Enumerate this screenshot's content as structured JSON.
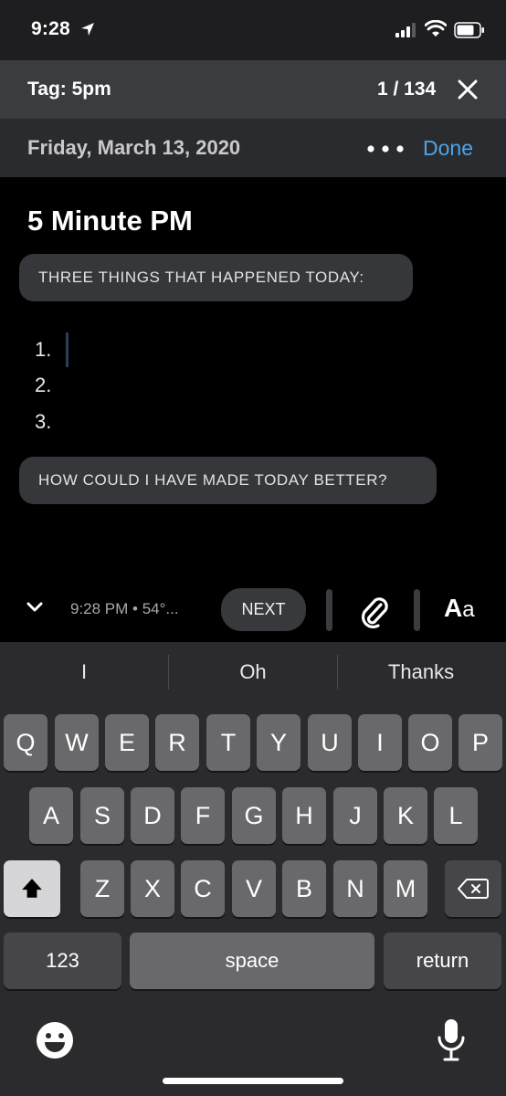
{
  "status_bar": {
    "time": "9:28"
  },
  "tag_bar": {
    "label": "Tag: 5pm",
    "count": "1 / 134"
  },
  "date_bar": {
    "date": "Friday, March 13, 2020",
    "done_label": "Done"
  },
  "entry": {
    "title": "5 Minute PM",
    "prompt_1": "THREE THINGS THAT HAPPENED TODAY:",
    "list": [
      "1.",
      "2.",
      "3."
    ],
    "prompt_2": "HOW COULD I HAVE MADE TODAY BETTER?"
  },
  "toolbar": {
    "meta": "9:28 PM • 54°...",
    "next_label": "NEXT",
    "format_big": "A",
    "format_small": "a"
  },
  "keyboard": {
    "suggestions": [
      "I",
      "Oh",
      "Thanks"
    ],
    "row1": [
      "Q",
      "W",
      "E",
      "R",
      "T",
      "Y",
      "U",
      "I",
      "O",
      "P"
    ],
    "row2": [
      "A",
      "S",
      "D",
      "F",
      "G",
      "H",
      "J",
      "K",
      "L"
    ],
    "row3": [
      "Z",
      "X",
      "C",
      "V",
      "B",
      "N",
      "M"
    ],
    "numbers_label": "123",
    "space_label": "space",
    "return_label": "return"
  },
  "colors": {
    "accent": "#4ea4e8",
    "background": "#000000",
    "prompt_bg": "#35373b",
    "keyboard_bg": "#2b2b2d"
  }
}
